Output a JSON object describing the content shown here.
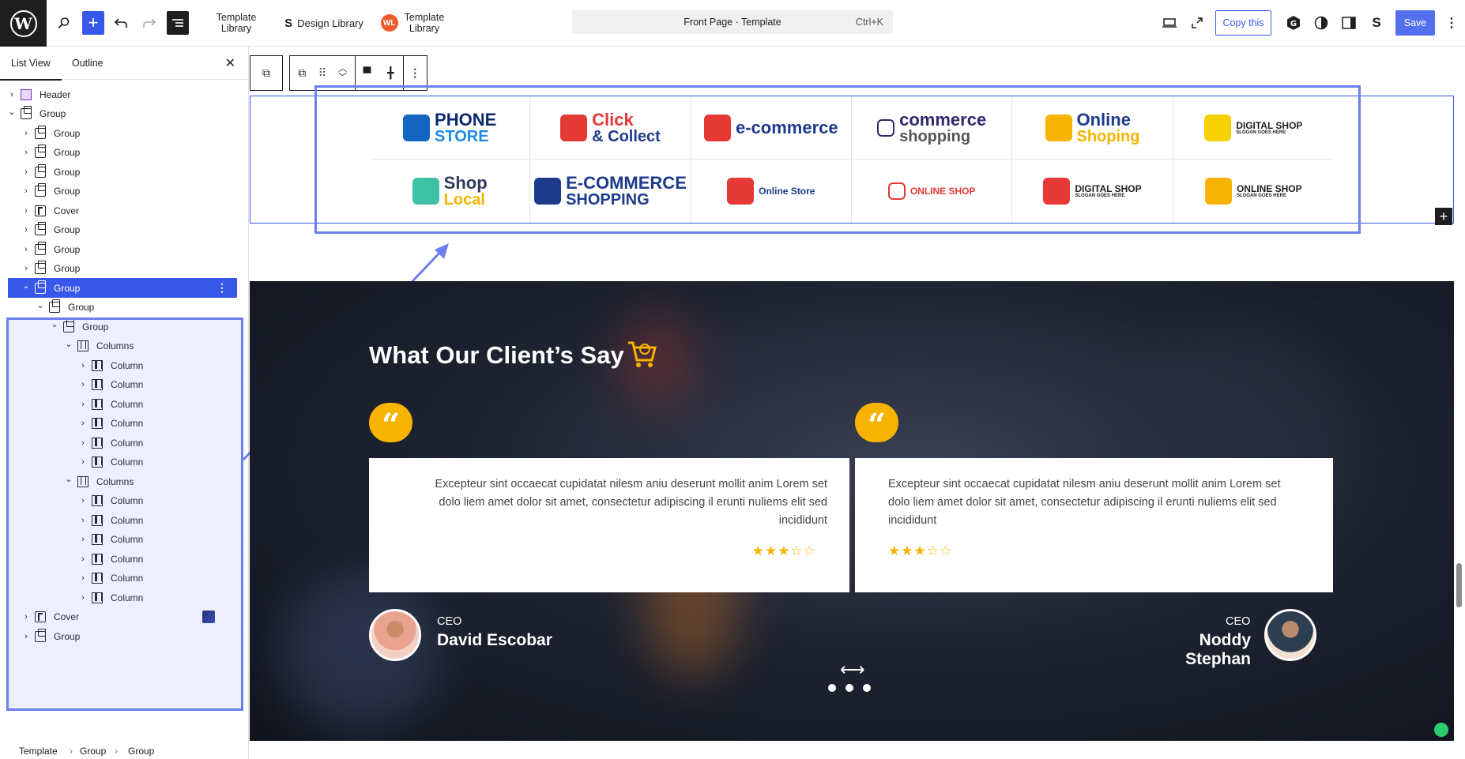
{
  "topbar": {
    "template_library_1": [
      "Template",
      "Library"
    ],
    "design_library": "Design Library",
    "template_library_2": [
      "Template",
      "Library"
    ],
    "command": "Front Page · Template",
    "shortcut": "Ctrl+K",
    "copy_label": "Copy this",
    "save_label": "Save"
  },
  "sidebar": {
    "tab_list": "List View",
    "tab_outline": "Outline",
    "tree": [
      {
        "label": "Header",
        "icon": "header",
        "depth": 0,
        "chev": "right"
      },
      {
        "label": "Group",
        "icon": "group",
        "depth": 0,
        "chev": "down"
      },
      {
        "label": "Group",
        "icon": "group",
        "depth": 1,
        "chev": "right"
      },
      {
        "label": "Group",
        "icon": "group",
        "depth": 1,
        "chev": "right"
      },
      {
        "label": "Group",
        "icon": "group",
        "depth": 1,
        "chev": "right"
      },
      {
        "label": "Group",
        "icon": "group",
        "depth": 1,
        "chev": "right"
      },
      {
        "label": "Cover",
        "icon": "cover",
        "depth": 1,
        "chev": "right"
      },
      {
        "label": "Group",
        "icon": "group",
        "depth": 1,
        "chev": "right"
      },
      {
        "label": "Group",
        "icon": "group",
        "depth": 1,
        "chev": "right"
      },
      {
        "label": "Group",
        "icon": "group",
        "depth": 1,
        "chev": "right"
      },
      {
        "label": "Group",
        "icon": "group",
        "depth": 1,
        "chev": "down",
        "selected": true
      },
      {
        "label": "Group",
        "icon": "group",
        "depth": 2,
        "chev": "down"
      },
      {
        "label": "Group",
        "icon": "group",
        "depth": 3,
        "chev": "down"
      },
      {
        "label": "Columns",
        "icon": "columns",
        "depth": 4,
        "chev": "down"
      },
      {
        "label": "Column",
        "icon": "column",
        "depth": 5,
        "chev": "right"
      },
      {
        "label": "Column",
        "icon": "column",
        "depth": 5,
        "chev": "right"
      },
      {
        "label": "Column",
        "icon": "column",
        "depth": 5,
        "chev": "right"
      },
      {
        "label": "Column",
        "icon": "column",
        "depth": 5,
        "chev": "right"
      },
      {
        "label": "Column",
        "icon": "column",
        "depth": 5,
        "chev": "right"
      },
      {
        "label": "Column",
        "icon": "column",
        "depth": 5,
        "chev": "right"
      },
      {
        "label": "Columns",
        "icon": "columns",
        "depth": 4,
        "chev": "down"
      },
      {
        "label": "Column",
        "icon": "column",
        "depth": 5,
        "chev": "right"
      },
      {
        "label": "Column",
        "icon": "column",
        "depth": 5,
        "chev": "right"
      },
      {
        "label": "Column",
        "icon": "column",
        "depth": 5,
        "chev": "right"
      },
      {
        "label": "Column",
        "icon": "column",
        "depth": 5,
        "chev": "right"
      },
      {
        "label": "Column",
        "icon": "column",
        "depth": 5,
        "chev": "right"
      },
      {
        "label": "Column",
        "icon": "column",
        "depth": 5,
        "chev": "right"
      },
      {
        "label": "Cover",
        "icon": "cover",
        "depth": 1,
        "chev": "right",
        "thumb": true
      },
      {
        "label": "Group",
        "icon": "group",
        "depth": 1,
        "chev": "right"
      }
    ]
  },
  "breadcrumb": [
    "Template",
    "Group",
    "Group"
  ],
  "logos": [
    {
      "line1": "PHONE",
      "line2": "STORE",
      "color1": "#0b2a6f",
      "color2": "#1e88e5",
      "mark": "#1565c0"
    },
    {
      "line1": "Click",
      "line2": "& Collect",
      "color1": "#e53935",
      "color2": "#1e3a8a",
      "mark": "#e53935"
    },
    {
      "line1": "e-commerce",
      "line2": "",
      "color1": "#1e3a8a",
      "color2": "#e53935",
      "mark": "#e53935"
    },
    {
      "line1": "commerce",
      "line2": "shopping",
      "color1": "#2e2a6b",
      "color2": "#555",
      "mark": "#ffffff"
    },
    {
      "line1": "Online",
      "line2": "Shoping",
      "color1": "#1e3a8a",
      "color2": "#f6b400",
      "mark": "#f6b400"
    },
    {
      "line1": "DIGITAL SHOP",
      "line2": "SLOGAN GOES HERE",
      "color1": "#1e1e1e",
      "color2": "#1e1e1e",
      "mark": "#f6d000"
    },
    {
      "line1": "Shop",
      "line2": "Local",
      "color1": "#2e3a59",
      "color2": "#f6b400",
      "mark": "#3ec1a5"
    },
    {
      "line1": "E-COMMERCE",
      "line2": "SHOPPING",
      "color1": "#1e3a8a",
      "color2": "#1e3a8a",
      "mark": "#1e3a8a"
    },
    {
      "line1": "Online Store",
      "line2": "",
      "color1": "#1e3a8a",
      "color2": "#1e3a8a",
      "mark": "#e53935"
    },
    {
      "line1": "ONLINE SHOP",
      "line2": "",
      "color1": "#e53935",
      "color2": "#e53935",
      "mark": "#ffffff"
    },
    {
      "line1": "DIGITAL SHOP",
      "line2": "SLOGAN GOES HERE",
      "color1": "#1e1e1e",
      "color2": "#1e1e1e",
      "mark": "#e53935"
    },
    {
      "line1": "ONLINE SHOP",
      "line2": "SLOGAN GOES HERE",
      "color1": "#1e1e1e",
      "color2": "#1e1e1e",
      "mark": "#f6b400"
    }
  ],
  "testimonials": {
    "title": "What Our Client’s Say",
    "quote_glyph": "“",
    "items": [
      {
        "text": "Excepteur sint occaecat cupidatat nilesm aniu deserunt mollit anim Lorem set dolo liem amet dolor sit amet, consectetur adipiscing il erunti nuliems elit sed incididunt",
        "stars": "★★★☆☆",
        "role": "CEO",
        "name": "David Escobar"
      },
      {
        "text": "Excepteur sint occaecat cupidatat nilesm aniu deserunt mollit anim Lorem set dolo liem amet dolor sit amet, consectetur adipiscing il erunti nuliems elit sed incididunt",
        "stars": "★★★☆☆",
        "role": "CEO",
        "name": "Noddy Stephan"
      }
    ]
  },
  "colors": {
    "accent": "#3858e9",
    "highlight": "#6b7ff0",
    "gold": "#f6b400"
  }
}
